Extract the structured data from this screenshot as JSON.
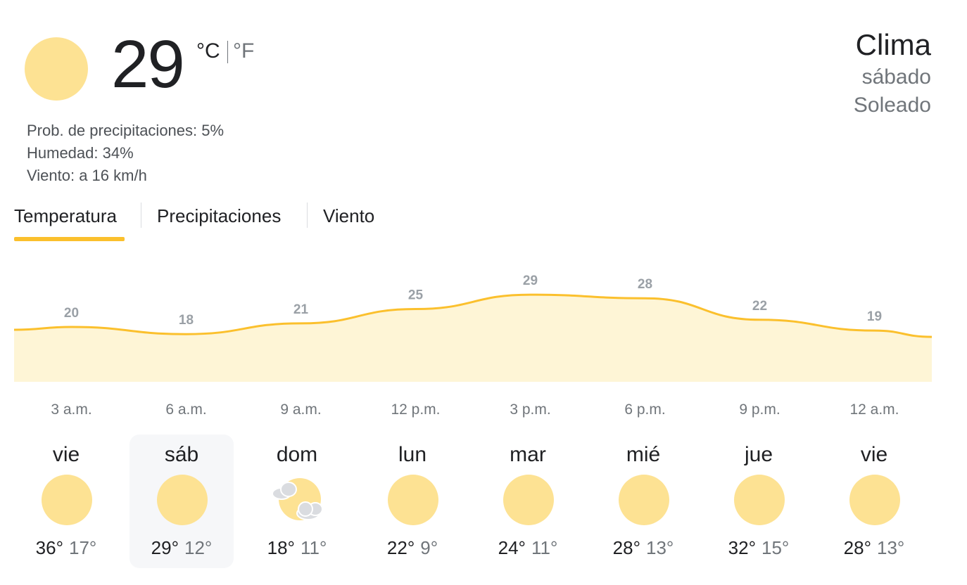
{
  "current": {
    "temperature": "29",
    "unit_c": "°C",
    "unit_f": "°F",
    "icon": "sunny-icon",
    "precipitation": "Prob. de precipitaciones: 5%",
    "humidity": "Humedad: 34%",
    "wind": "Viento: a 16 km/h"
  },
  "header": {
    "title": "Clima",
    "day": "sábado",
    "condition": "Soleado"
  },
  "tabs": [
    {
      "label": "Temperatura",
      "selected": true
    },
    {
      "label": "Precipitaciones",
      "selected": false
    },
    {
      "label": "Viento",
      "selected": false
    }
  ],
  "colors": {
    "accent": "#fbc02d",
    "chart_line": "#fbc02d",
    "chart_fill": "#fef5d6",
    "sun": "#fde293"
  },
  "chart_data": {
    "type": "area",
    "x": [
      "3 a.m.",
      "6 a.m.",
      "9 a.m.",
      "12 p.m.",
      "3 p.m.",
      "6 p.m.",
      "9 p.m.",
      "12 a.m."
    ],
    "values": [
      20,
      18,
      21,
      25,
      29,
      28,
      22,
      19
    ],
    "labels": [
      "20",
      "18",
      "21",
      "25",
      "29",
      "28",
      "22",
      "19"
    ]
  },
  "forecast": [
    {
      "day": "vie",
      "high": "36°",
      "low": "17°",
      "icon": "sunny-icon",
      "selected": false
    },
    {
      "day": "sáb",
      "high": "29°",
      "low": "12°",
      "icon": "sunny-icon",
      "selected": true
    },
    {
      "day": "dom",
      "high": "18°",
      "low": "11°",
      "icon": "partly-cloudy-icon",
      "selected": false
    },
    {
      "day": "lun",
      "high": "22°",
      "low": "9°",
      "icon": "sunny-icon",
      "selected": false
    },
    {
      "day": "mar",
      "high": "24°",
      "low": "11°",
      "icon": "sunny-icon",
      "selected": false
    },
    {
      "day": "mié",
      "high": "28°",
      "low": "13°",
      "icon": "sunny-icon",
      "selected": false
    },
    {
      "day": "jue",
      "high": "32°",
      "low": "15°",
      "icon": "sunny-icon",
      "selected": false
    },
    {
      "day": "vie",
      "high": "28°",
      "low": "13°",
      "icon": "sunny-icon",
      "selected": false
    }
  ]
}
